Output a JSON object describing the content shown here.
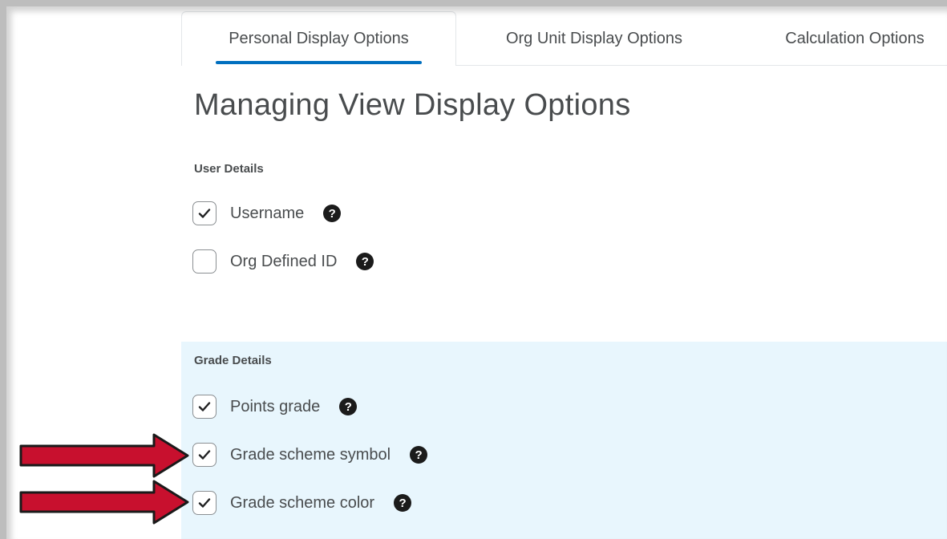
{
  "tabs": [
    {
      "label": "Personal Display Options",
      "active": true
    },
    {
      "label": "Org Unit Display Options",
      "active": false
    },
    {
      "label": "Calculation Options",
      "active": false
    }
  ],
  "page_title": "Managing View Display Options",
  "user_details": {
    "label": "User Details",
    "options": [
      {
        "label": "Username",
        "checked": true,
        "help_icon": "question-circle-icon"
      },
      {
        "label": "Org Defined ID",
        "checked": false,
        "help_icon": "question-circle-icon"
      }
    ]
  },
  "grade_details": {
    "label": "Grade Details",
    "options": [
      {
        "label": "Points grade",
        "checked": true,
        "help_icon": "question-circle-icon"
      },
      {
        "label": "Grade scheme symbol",
        "checked": true,
        "help_icon": "question-circle-icon"
      },
      {
        "label": "Grade scheme color",
        "checked": true,
        "help_icon": "question-circle-icon"
      }
    ]
  },
  "colors": {
    "active_tab_underline": "#006fbf",
    "grade_panel_bg": "#e8f6fd",
    "annotation_arrow": "#c8102e"
  },
  "help_glyph": "?"
}
